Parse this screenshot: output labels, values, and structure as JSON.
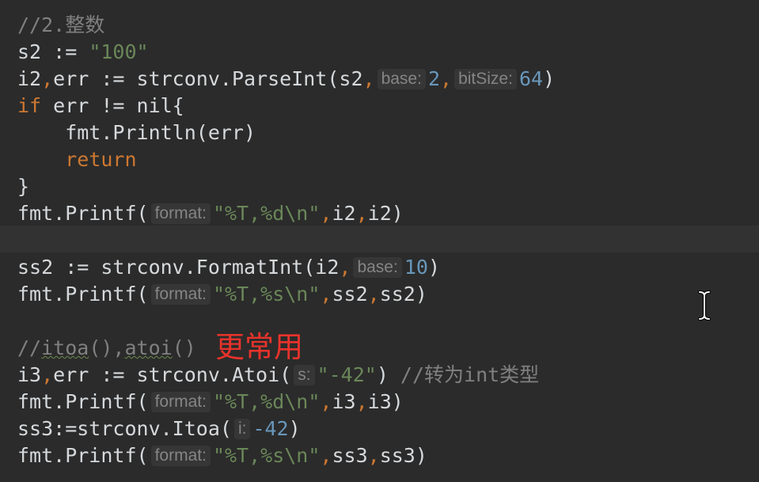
{
  "editor": {
    "lines": {
      "l1": {
        "comment": "//2.整数"
      },
      "l2": {
        "code": "s2 := ",
        "str": "\"100\""
      },
      "l3": {
        "code": "i2",
        "comma1": ",",
        "code2": "err := strconv.ParseInt(s2",
        "comma2": ",",
        "hint1": "base:",
        "num1": "2",
        "comma3": ",",
        "hint2": "bitSize:",
        "num2": "64",
        "close": ")"
      },
      "l4": {
        "kw": "if",
        "code": " err != nil{"
      },
      "l5": {
        "code": "    fmt.Println(err)"
      },
      "l6": {
        "indent": "    ",
        "kw": "return"
      },
      "l7": {
        "code": "}"
      },
      "l8": {
        "code": "fmt.Printf(",
        "hint": "format:",
        "str": "\"%T,%d\\n\"",
        "comma1": ",",
        "code2": "i2",
        "comma2": ",",
        "code3": "i2)"
      },
      "l10": {
        "code": "ss2 := strconv.FormatInt(i2",
        "comma": ",",
        "hint": "base:",
        "num": "10",
        "close": ")"
      },
      "l11": {
        "code": "fmt.Printf(",
        "hint": "format:",
        "str": "\"%T,%s\\n\"",
        "comma1": ",",
        "code2": "ss2",
        "comma2": ",",
        "code3": "ss2)"
      },
      "l13": {
        "comment_prefix": "//",
        "fn1": "itoa",
        "mid": "(),",
        "fn2": "atoi",
        "suffix": "()"
      },
      "l14": {
        "code": "i3",
        "comma": ",",
        "code2": "err := strconv.Atoi(",
        "hint": "s:",
        "str": "\"-42\"",
        "close": ")",
        "comment": " //转为int类型"
      },
      "l15": {
        "code": "fmt.Printf(",
        "hint": "format:",
        "str": "\"%T,%d\\n\"",
        "comma1": ",",
        "code2": "i3",
        "comma2": ",",
        "code3": "i3)"
      },
      "l16": {
        "code": "ss3:=strconv.Itoa(",
        "hint": "i:",
        "num": "-42",
        "close": ")"
      },
      "l17": {
        "code": "fmt.Printf(",
        "hint": "format:",
        "str": "\"%T,%s\\n\"",
        "comma1": ",",
        "code2": "ss3",
        "comma2": ",",
        "code3": "ss3)"
      }
    },
    "annotation": "更常用"
  },
  "colors": {
    "background": "#2b2b2b",
    "keyword": "#cc7832",
    "string": "#6a8759",
    "number": "#6897bb",
    "comment": "#808080",
    "annotation": "#e8332b"
  },
  "icons": {
    "cursor": "text-cursor-icon"
  }
}
